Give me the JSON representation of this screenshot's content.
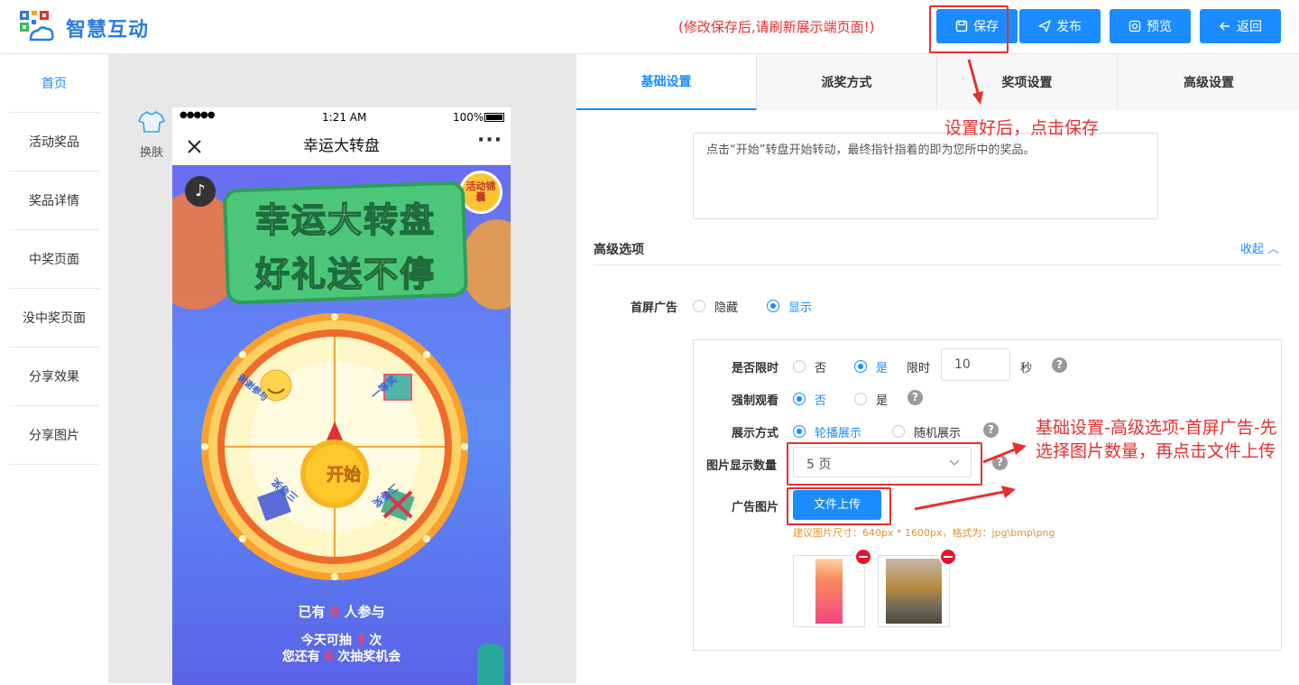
{
  "header": {
    "brand": "智慧互动",
    "notice": "(修改保存后,请刷新展示端页面!)",
    "buttons": {
      "save": "保存",
      "publish": "发布",
      "preview": "预览",
      "back": "返回"
    }
  },
  "sidebar": {
    "items": [
      {
        "label": "首页"
      },
      {
        "label": "活动奖品"
      },
      {
        "label": "奖品详情"
      },
      {
        "label": "中奖页面"
      },
      {
        "label": "没中奖页面"
      },
      {
        "label": "分享效果"
      },
      {
        "label": "分享图片"
      }
    ]
  },
  "preview": {
    "skin_label": "换肤",
    "status": {
      "signal": "●●●●●",
      "time": "1:21 AM",
      "battery": "100%"
    },
    "nav_title": "幸运大转盘",
    "banner": {
      "line1": "幸运大转盘",
      "line2": "好礼送不停",
      "badge": "活动锦囊"
    },
    "wheel": {
      "start": "开始",
      "sectors": [
        "谢谢参与",
        "一等奖",
        "三等奖",
        "二等奖"
      ]
    },
    "participants": {
      "prefix": "已有",
      "count": "0",
      "suffix": "人参与"
    },
    "today": {
      "prefix": "今天可抽",
      "count": "3",
      "suffix": "次"
    },
    "remaining": {
      "prefix": "您还有",
      "count": "6",
      "suffix": "次抽奖机会"
    }
  },
  "tabs": [
    {
      "label": "基础设置"
    },
    {
      "label": "派奖方式"
    },
    {
      "label": "奖项设置"
    },
    {
      "label": "高级设置"
    }
  ],
  "settings": {
    "description": "点击“开始”转盘开始转动，最终指针指着的即为您所中的奖品。",
    "section_title": "高级选项",
    "collapse_label": "收起 ︿",
    "splash_ad": {
      "label": "首屏广告",
      "options": [
        "隐藏",
        "显示"
      ],
      "selected": "显示"
    },
    "time_limit": {
      "label": "是否限时",
      "options": [
        "否",
        "是"
      ],
      "selected": "是",
      "limit_label": "限时",
      "value": "10",
      "unit": "秒"
    },
    "force_watch": {
      "label": "强制观看",
      "options": [
        "否",
        "是"
      ],
      "selected": "否"
    },
    "display_mode": {
      "label": "展示方式",
      "options": [
        "轮播展示",
        "随机展示"
      ],
      "selected": "轮播展示"
    },
    "image_count": {
      "label": "图片显示数量",
      "value": "5 页"
    },
    "ad_image": {
      "label": "广告图片",
      "upload_button": "文件上传",
      "hint": "建议图片尺寸：640px * 1600px，格式为：jpg\\bmp\\png"
    },
    "help_glyph": "?"
  },
  "annotations": {
    "save_hint": "设置好后，点击保存",
    "upload_hint": "基础设置-高级选项-首屏广告-先选择图片数量，再点击文件上传"
  },
  "colors": {
    "accent": "#1a8cff",
    "annotation": "#e5302f",
    "brand": "#2a7be4"
  }
}
